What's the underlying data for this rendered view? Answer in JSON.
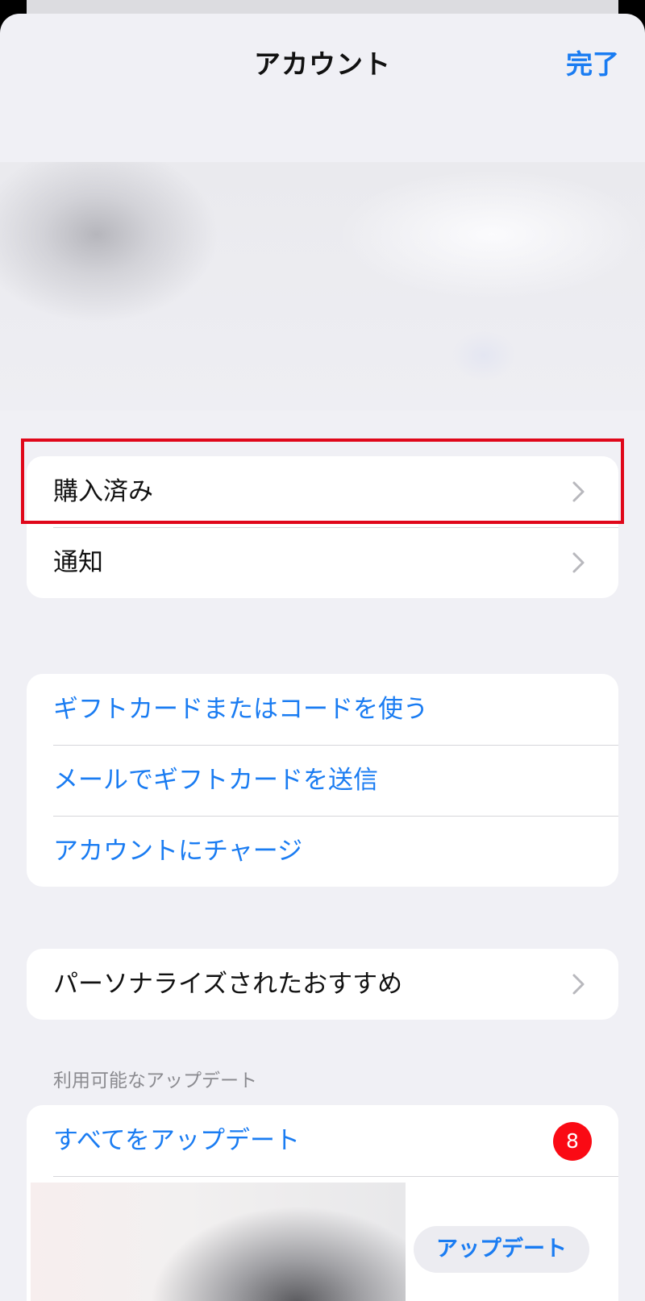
{
  "header": {
    "title": "アカウント",
    "done_label": "完了"
  },
  "account_group": {
    "items": [
      {
        "label": "購入済み"
      },
      {
        "label": "通知"
      }
    ]
  },
  "gift_group": {
    "items": [
      {
        "label": "ギフトカードまたはコードを使う"
      },
      {
        "label": "メールでギフトカードを送信"
      },
      {
        "label": "アカウントにチャージ"
      }
    ]
  },
  "personalize_group": {
    "label": "パーソナライズされたおすすめ"
  },
  "updates": {
    "section_title": "利用可能なアップデート",
    "update_all_label": "すべてをアップデート",
    "badge_count": "8",
    "app_update_label": "アップデート"
  },
  "colors": {
    "accent": "#1a7cf2",
    "badge": "#fa0a14",
    "highlight": "#e0071a",
    "background": "#f0f0f5"
  }
}
